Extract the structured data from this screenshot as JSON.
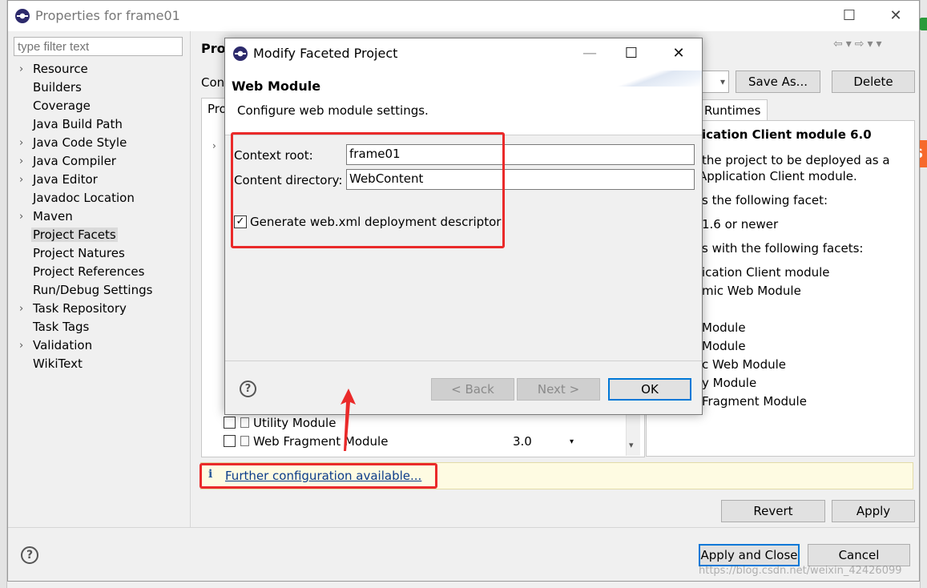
{
  "props_window": {
    "title": "Properties for frame01",
    "filter_placeholder": "type filter text",
    "tree": [
      {
        "label": "Resource",
        "expandable": true
      },
      {
        "label": "Builders",
        "expandable": false
      },
      {
        "label": "Coverage",
        "expandable": false
      },
      {
        "label": "Java Build Path",
        "expandable": false
      },
      {
        "label": "Java Code Style",
        "expandable": true
      },
      {
        "label": "Java Compiler",
        "expandable": true
      },
      {
        "label": "Java Editor",
        "expandable": true
      },
      {
        "label": "Javadoc Location",
        "expandable": false
      },
      {
        "label": "Maven",
        "expandable": true
      },
      {
        "label": "Project Facets",
        "expandable": false,
        "selected": true
      },
      {
        "label": "Project Natures",
        "expandable": false
      },
      {
        "label": "Project References",
        "expandable": false
      },
      {
        "label": "Run/Debug Settings",
        "expandable": false
      },
      {
        "label": "Task Repository",
        "expandable": true
      },
      {
        "label": "Task Tags",
        "expandable": false
      },
      {
        "label": "Validation",
        "expandable": true
      },
      {
        "label": "WikiText",
        "expandable": false
      }
    ],
    "page_title": "Proj",
    "config_label": "Con",
    "facets_header": "Pro",
    "save_as_label": "Save As...",
    "delete_label": "Delete",
    "runtimes_tab": "Runtimes",
    "facet_rows": [
      {
        "name": "Utility Module",
        "version": ""
      },
      {
        "name": "Web Fragment Module",
        "version": "3.0"
      }
    ],
    "details": [
      {
        "text": "ication Client module 6.0",
        "bold": true
      },
      {
        "text": "the project to be deployed as a"
      },
      {
        "text": "Application Client module."
      },
      {
        "text": "s the following facet:"
      },
      {
        "text": "1.6 or newer"
      },
      {
        "text": "s with the following facets:"
      },
      {
        "text": "ication Client module"
      },
      {
        "text": "mic Web Module"
      },
      {
        "text": ""
      },
      {
        "text": "Module"
      },
      {
        "text": "Module"
      },
      {
        "text": "c Web Module"
      },
      {
        "text": "y Module"
      },
      {
        "text": "Fragment Module"
      }
    ],
    "info_link": "Further configuration available...",
    "revert_label": "Revert",
    "apply_label": "Apply",
    "apply_close_label": "Apply and Close",
    "cancel_label": "Cancel",
    "help_glyph": "?"
  },
  "modal": {
    "title": "Modify Faceted Project",
    "heading": "Web Module",
    "description": "Configure web module settings.",
    "context_root_label": "Context root:",
    "context_root_value": "frame01",
    "content_dir_label": "Content directory:",
    "content_dir_value": "WebContent",
    "generate_label": "Generate web.xml deployment descriptor",
    "generate_checked": true,
    "back_label": "< Back",
    "next_label": "Next >",
    "ok_label": "OK",
    "help_glyph": "?"
  },
  "watermark": "https://blog.csdn.net/weixin_42426099",
  "colors": {
    "highlight_red": "#ea2a2a",
    "default_button_border": "#0078d7",
    "info_bar_bg": "#fefbe2",
    "link": "#0b3c8a"
  }
}
